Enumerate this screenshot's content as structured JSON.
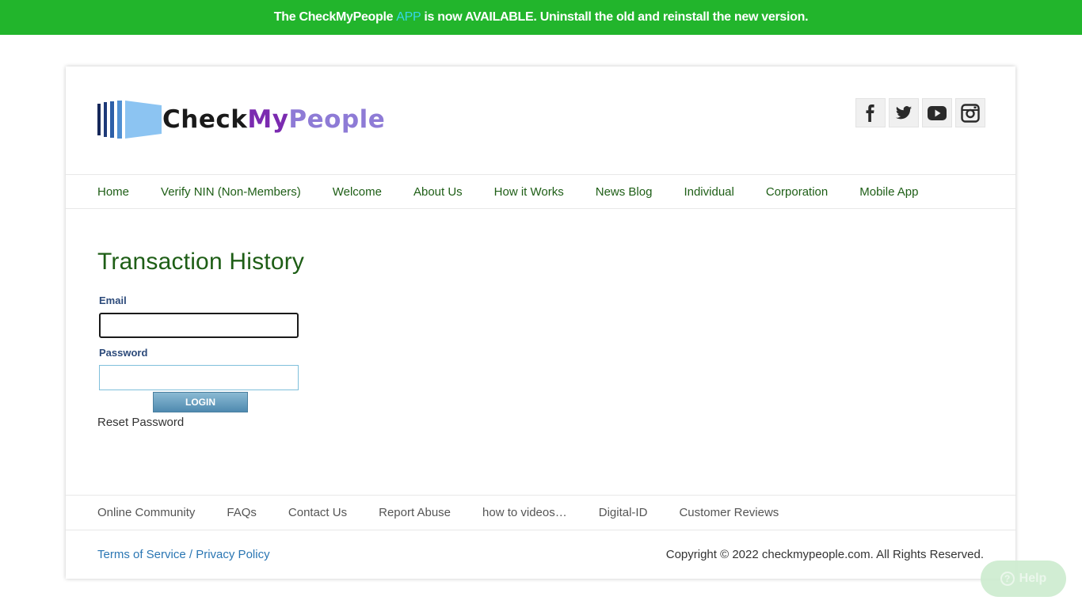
{
  "banner": {
    "part1": "The CheckMyPeople",
    "app": "APP",
    "part2": "is now AVAILABLE. Uninstall the old and reinstall the new version.",
    "bg_color": "#22b52c",
    "app_color": "#35d6e8"
  },
  "logo": {
    "word1": "Check",
    "word2": "My",
    "word3": "People"
  },
  "social": [
    "facebook-icon",
    "twitter-icon",
    "youtube-icon",
    "instagram-icon"
  ],
  "nav": {
    "items": [
      "Home",
      "Verify NIN (Non-Members)",
      "Welcome",
      "About Us",
      "How it Works",
      "News Blog",
      "Individual",
      "Corporation",
      "Mobile App"
    ]
  },
  "main": {
    "title": "Transaction History",
    "email_label": "Email",
    "email_value": "",
    "password_label": "Password",
    "password_value": "",
    "login_label": "LOGIN",
    "reset_label": "Reset Password"
  },
  "footer": {
    "links": [
      "Online Community",
      "FAQs",
      "Contact Us",
      "Report Abuse",
      "how to videos…",
      "Digital-ID",
      "Customer Reviews"
    ],
    "terms": "Terms of Service",
    "separator": " / ",
    "privacy": "Privacy Policy",
    "copyright": "Copyright © 2022 checkmypeople.com. All Rights Reserved."
  },
  "help": {
    "label": "Help",
    "icon": "?"
  },
  "colors": {
    "nav_text": "#1e5e16",
    "link_blue": "#2a76b3"
  }
}
